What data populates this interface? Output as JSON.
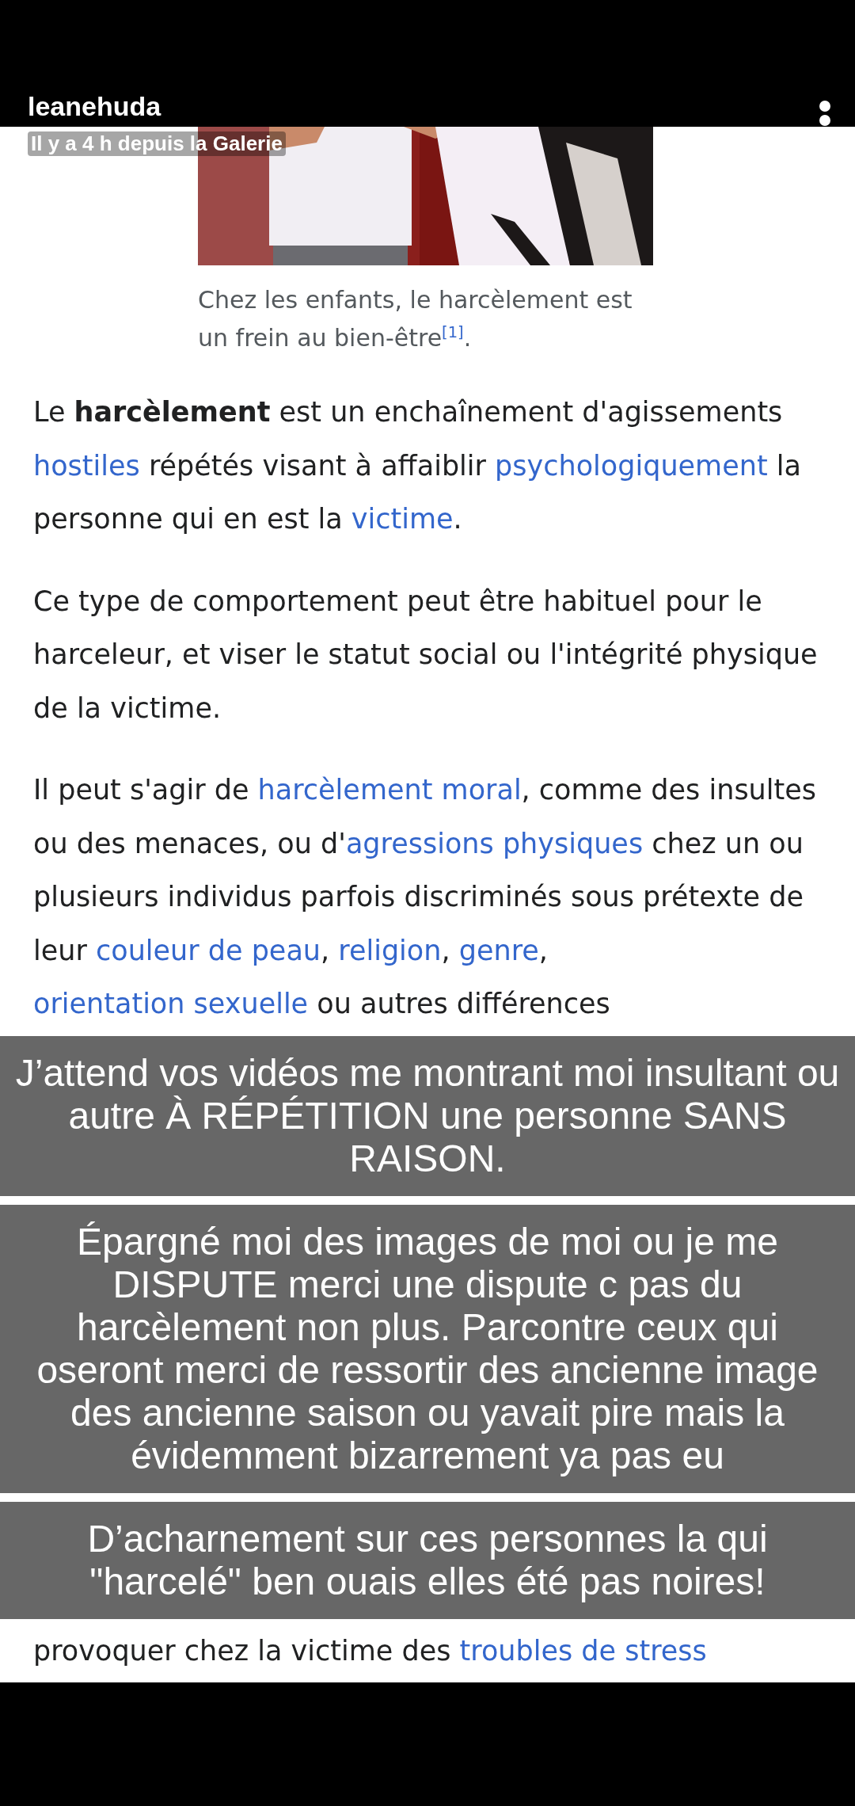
{
  "story": {
    "username": "leanehuda",
    "subtitle": "Il y a 4 h depuis la Galerie"
  },
  "article": {
    "figure": {
      "kind": "picture",
      "caption": [
        {
          "kind": "plain",
          "text": "Chez les enfants, le harcèlement est un frein au bien-être"
        },
        {
          "kind": "ref",
          "text": "[1]"
        },
        {
          "kind": "plain",
          "text": "."
        }
      ]
    },
    "paragraphs": [
      [
        {
          "kind": "plain",
          "text": "Le "
        },
        {
          "kind": "bold",
          "text": "harcèlement"
        },
        {
          "kind": "plain",
          "text": " est un enchaînement d'agissements "
        },
        {
          "kind": "link",
          "text": "hostiles"
        },
        {
          "kind": "plain",
          "text": " répétés visant à affaiblir "
        },
        {
          "kind": "link",
          "text": "psychologiquement"
        },
        {
          "kind": "plain",
          "text": " la personne qui en est la "
        },
        {
          "kind": "link",
          "text": "victime"
        },
        {
          "kind": "plain",
          "text": "."
        }
      ],
      [
        {
          "kind": "plain",
          "text": "Ce type de comportement peut être habituel pour le harceleur, et viser le statut social ou l'intégrité physique de la victime."
        }
      ],
      [
        {
          "kind": "plain",
          "text": "Il peut s'agir de "
        },
        {
          "kind": "link",
          "text": "harcèlement moral"
        },
        {
          "kind": "plain",
          "text": ", comme des insultes ou des menaces, ou d'"
        },
        {
          "kind": "link",
          "text": "agressions physiques"
        },
        {
          "kind": "plain",
          "text": " chez un ou plusieurs individus parfois discriminés sous prétexte de leur "
        },
        {
          "kind": "link",
          "text": "couleur de peau"
        },
        {
          "kind": "plain",
          "text": ", "
        },
        {
          "kind": "link",
          "text": "religion"
        },
        {
          "kind": "plain",
          "text": ", "
        },
        {
          "kind": "link",
          "text": "genre"
        },
        {
          "kind": "plain",
          "text": ", "
        },
        {
          "kind": "link",
          "text": "orientation sexuelle"
        },
        {
          "kind": "plain",
          "text": " ou autres différences"
        }
      ]
    ],
    "tail": [
      {
        "kind": "plain",
        "text": "provoquer chez la victime des "
      },
      {
        "kind": "link",
        "text": "troubles de stress"
      }
    ]
  },
  "captions": [
    "J’attend vos vidéos me montrant moi insultant ou autre À RÉPÉTITION une personne SANS RAISON.",
    "Épargné moi des images de moi ou je me DISPUTE merci une dispute c pas du harcèlement non plus. Parcontre ceux qui oseront merci de ressortir des ancienne image des ancienne saison ou yavait pire mais la évidemment bizarrement ya pas eu",
    "D’acharnement sur ces personnes la qui \"harcelé\" ben ouais elles été pas noires!"
  ]
}
